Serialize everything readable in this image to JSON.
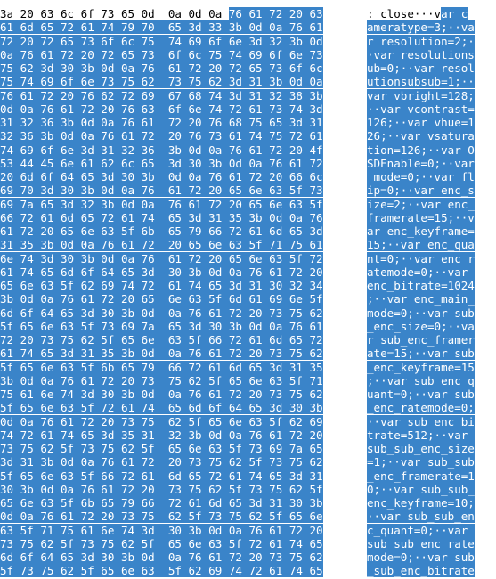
{
  "hex_rows": [
    "3a 20 63 6c 6f 73 65 0d  0a 0d 0a 76 61 72 20 63",
    "61 6d 65 72 61 74 79 70  65 3d 33 3b 0d 0a 76 61",
    "72 20 72 65 73 6f 6c 75  74 69 6f 6e 3d 32 3b 0d",
    "0a 76 61 72 20 72 65 73  6f 6c 75 74 69 6f 6e 73",
    "75 62 3d 30 3b 0d 0a 76  61 72 20 72 65 73 6f 6c",
    "75 74 69 6f 6e 73 75 62  73 75 62 3d 31 3b 0d 0a",
    "76 61 72 20 76 62 72 69  67 68 74 3d 31 32 38 3b",
    "0d 0a 76 61 72 20 76 63  6f 6e 74 72 61 73 74 3d",
    "31 32 36 3b 0d 0a 76 61  72 20 76 68 75 65 3d 31",
    "32 36 3b 0d 0a 76 61 72  20 76 73 61 74 75 72 61",
    "74 69 6f 6e 3d 31 32 36  3b 0d 0a 76 61 72 20 4f",
    "53 44 45 6e 61 62 6c 65  3d 30 3b 0d 0a 76 61 72",
    "20 6d 6f 64 65 3d 30 3b  0d 0a 76 61 72 20 66 6c",
    "69 70 3d 30 3b 0d 0a 76  61 72 20 65 6e 63 5f 73",
    "69 7a 65 3d 32 3b 0d 0a  76 61 72 20 65 6e 63 5f",
    "66 72 61 6d 65 72 61 74  65 3d 31 35 3b 0d 0a 76",
    "61 72 20 65 6e 63 5f 6b  65 79 66 72 61 6d 65 3d",
    "31 35 3b 0d 0a 76 61 72  20 65 6e 63 5f 71 75 61",
    "6e 74 3d 30 3b 0d 0a 76  61 72 20 65 6e 63 5f 72",
    "61 74 65 6d 6f 64 65 3d  30 3b 0d 0a 76 61 72 20",
    "65 6e 63 5f 62 69 74 72  61 74 65 3d 31 30 32 34",
    "3b 0d 0a 76 61 72 20 65  6e 63 5f 6d 61 69 6e 5f",
    "6d 6f 64 65 3d 30 3b 0d  0a 76 61 72 20 73 75 62",
    "5f 65 6e 63 5f 73 69 7a  65 3d 30 3b 0d 0a 76 61",
    "72 20 73 75 62 5f 65 6e  63 5f 66 72 61 6d 65 72",
    "61 74 65 3d 31 35 3b 0d  0a 76 61 72 20 73 75 62",
    "5f 65 6e 63 5f 6b 65 79  66 72 61 6d 65 3d 31 35",
    "3b 0d 0a 76 61 72 20 73  75 62 5f 65 6e 63 5f 71",
    "75 61 6e 74 3d 30 3b 0d  0a 76 61 72 20 73 75 62",
    "5f 65 6e 63 5f 72 61 74  65 6d 6f 64 65 3d 30 3b",
    "0d 0a 76 61 72 20 73 75  62 5f 65 6e 63 5f 62 69",
    "74 72 61 74 65 3d 35 31  32 3b 0d 0a 76 61 72 20",
    "73 75 62 5f 73 75 62 5f  65 6e 63 5f 73 69 7a 65",
    "3d 31 3b 0d 0a 76 61 72  20 73 75 62 5f 73 75 62",
    "5f 65 6e 63 5f 66 72 61  6d 65 72 61 74 65 3d 31",
    "30 3b 0d 0a 76 61 72 20  73 75 62 5f 73 75 62 5f",
    "65 6e 63 5f 6b 65 79 66  72 61 6d 65 3d 31 30 3b",
    "0d 0a 76 61 72 20 73 75  62 5f 73 75 62 5f 65 6e",
    "63 5f 71 75 61 6e 74 3d  30 3b 0d 0a 76 61 72 20",
    "73 75 62 5f 73 75 62 5f  65 6e 63 5f 72 61 74 65",
    "6d 6f 64 65 3d 30 3b 0d  0a 76 61 72 20 73 75 62",
    "5f 73 75 62 5f 65 6e 63  5f 62 69 74 72 61 74 65"
  ],
  "ascii_rows": [
    ": close···var c",
    "ameratype=3;··va",
    "r resolution=2;·",
    "·var resolutions",
    "ub=0;··var resol",
    "utionsubsub=1;··",
    "var vbright=128;",
    "··var vcontrast=",
    "126;··var vhue=1",
    "26;··var vsatura",
    "tion=126;··var O",
    "SDEnable=0;··var",
    " mode=0;··var fl",
    "ip=0;··var enc_s",
    "ize=2;··var enc_",
    "framerate=15;··v",
    "ar enc_keyframe=",
    "15;··var enc_qua",
    "nt=0;··var enc_r",
    "atemode=0;··var ",
    "enc_bitrate=1024",
    ";··var enc_main_",
    "mode=0;··var sub",
    "_enc_size=0;··va",
    "r sub_enc_framer",
    "ate=15;··var sub",
    "_enc_keyframe=15",
    ";··var sub_enc_q",
    "uant=0;··var sub",
    "_enc_ratemode=0;",
    "··var sub_enc_bi",
    "trate=512;··var ",
    "sub_sub_enc_size",
    "=1;··var sub_sub",
    "_enc_framerate=1",
    "0;··var sub_sub_",
    "enc_keyframe=10;",
    "··var sub_sub_en",
    "c_quant=0;··var ",
    "sub_sub_enc_rate",
    "mode=0;··var sub",
    "_sub_enc_bitrate"
  ],
  "colors": {
    "selection": "#3a84c9",
    "selection_text": "#ffffff",
    "text": "#000000",
    "background": "#ffffff"
  }
}
